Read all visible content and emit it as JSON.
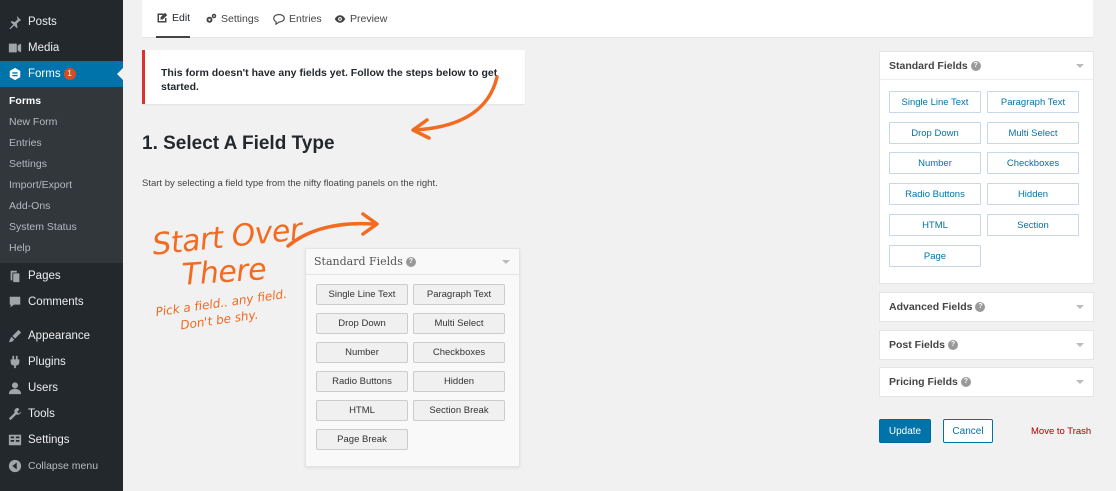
{
  "sidebar": {
    "items_top": [
      {
        "label": "Posts",
        "icon": "pin-icon"
      },
      {
        "label": "Media",
        "icon": "media-icon"
      }
    ],
    "forms": {
      "label": "Forms",
      "badge": "1",
      "icon": "forms-icon"
    },
    "submenu": [
      "Forms",
      "New Form",
      "Entries",
      "Settings",
      "Import/Export",
      "Add-Ons",
      "System Status",
      "Help"
    ],
    "items_mid": [
      {
        "label": "Pages",
        "icon": "pages-icon"
      },
      {
        "label": "Comments",
        "icon": "comments-icon"
      }
    ],
    "items_bottom": [
      {
        "label": "Appearance",
        "icon": "appearance-icon"
      },
      {
        "label": "Plugins",
        "icon": "plugins-icon"
      },
      {
        "label": "Users",
        "icon": "users-icon"
      },
      {
        "label": "Tools",
        "icon": "tools-icon"
      },
      {
        "label": "Settings",
        "icon": "settings-icon"
      }
    ],
    "collapse": "Collapse menu"
  },
  "tabs": [
    "Edit",
    "Settings",
    "Entries",
    "Preview"
  ],
  "notice": "This form doesn't have any fields yet. Follow the steps below to get started.",
  "heading": "1. Select A Field Type",
  "help_text": "Start by selecting a field type from the nifty floating panels on the right.",
  "illustration": {
    "title_line1": "Start Over",
    "title_line2": "There",
    "sub_line1": "Pick a field.. any field.",
    "sub_line2": "Don't be shy.",
    "panel_title": "Standard Fields",
    "buttons": [
      "Single Line Text",
      "Paragraph Text",
      "Drop Down",
      "Multi Select",
      "Number",
      "Checkboxes",
      "Radio Buttons",
      "Hidden",
      "HTML",
      "Section Break",
      "Page Break"
    ]
  },
  "standard_fields": {
    "title": "Standard Fields",
    "buttons": [
      "Single Line Text",
      "Paragraph Text",
      "Drop Down",
      "Multi Select",
      "Number",
      "Checkboxes",
      "Radio Buttons",
      "Hidden",
      "HTML",
      "Section",
      "Page"
    ]
  },
  "collapsed_panels": [
    "Advanced Fields",
    "Post Fields",
    "Pricing Fields"
  ],
  "actions": {
    "update": "Update",
    "cancel": "Cancel",
    "trash": "Move to Trash"
  },
  "colors": {
    "accent": "#0073aa",
    "sidebar": "#23282d",
    "orange": "#f26b21",
    "error": "#dc3232"
  }
}
